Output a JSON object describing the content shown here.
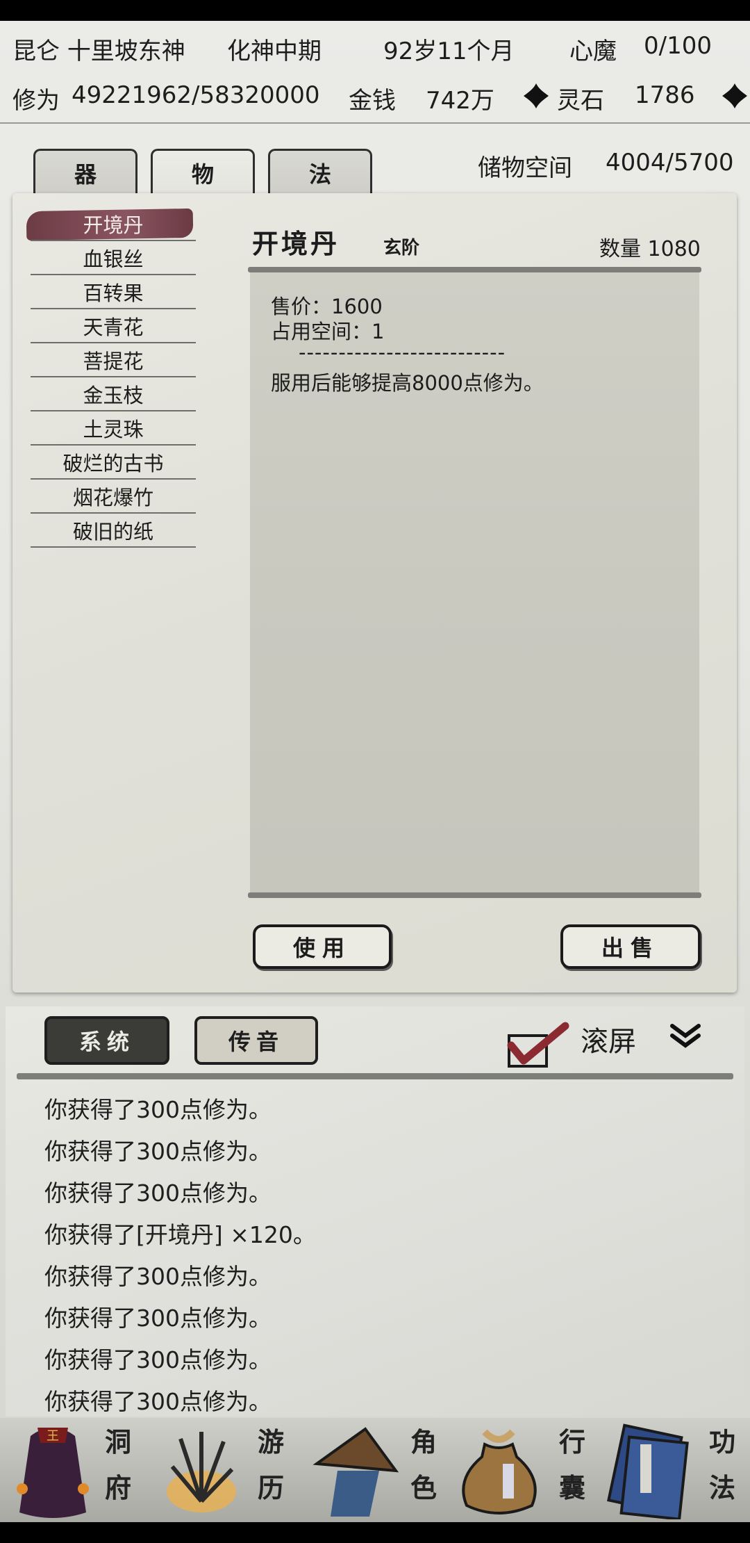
{
  "status": {
    "location": "昆仑 十里坡东神",
    "realm": "化神中期",
    "age": "92岁11个月",
    "heart_demon_label": "心魔",
    "heart_demon_value": "0/100",
    "cultivation_label": "修为",
    "cultivation_value": "49221962/58320000",
    "money_label": "金钱",
    "money_value": "742万",
    "spirit_stone_label": "灵石",
    "spirit_stone_value": "1786"
  },
  "tabs": [
    {
      "label": "器"
    },
    {
      "label": "物"
    },
    {
      "label": "法"
    }
  ],
  "storage": {
    "label": "储物空间",
    "value": "4004/5700"
  },
  "items": [
    {
      "label": "开境丹"
    },
    {
      "label": "血银丝"
    },
    {
      "label": "百转果"
    },
    {
      "label": "天青花"
    },
    {
      "label": "菩提花"
    },
    {
      "label": "金玉枝"
    },
    {
      "label": "土灵珠"
    },
    {
      "label": "破烂的古书"
    },
    {
      "label": "烟花爆竹"
    },
    {
      "label": "破旧的纸"
    }
  ],
  "detail": {
    "name": "开境丹",
    "grade": "玄阶",
    "quantity": "数量 1080",
    "price": "售价：1600",
    "space": "占用空间：1",
    "divider": "--------------------------",
    "description": "服用后能够提高8000点修为。"
  },
  "actions": {
    "use": "使用",
    "sell": "出售"
  },
  "log": {
    "tabs": [
      {
        "label": "系统"
      },
      {
        "label": "传音"
      }
    ],
    "scroll_label": "滚屏",
    "lines": [
      "你获得了300点修为。",
      "你获得了300点修为。",
      "你获得了300点修为。",
      "你获得了[开境丹] ×120。",
      "你获得了300点修为。",
      "你获得了300点修为。",
      "你获得了300点修为。",
      "你获得了300点修为。"
    ]
  },
  "nav": [
    {
      "label_top": "洞",
      "label_bottom": "府",
      "icon": "cave-icon"
    },
    {
      "label_top": "游",
      "label_bottom": "历",
      "icon": "travel-icon"
    },
    {
      "label_top": "角",
      "label_bottom": "色",
      "icon": "character-icon"
    },
    {
      "label_top": "行",
      "label_bottom": "囊",
      "icon": "bag-icon"
    },
    {
      "label_top": "功",
      "label_bottom": "法",
      "icon": "skill-book-icon"
    }
  ],
  "colors": {
    "selected_item": "#7a4550",
    "panel": "#e4e4dc",
    "paper": "#cbcbc2"
  }
}
